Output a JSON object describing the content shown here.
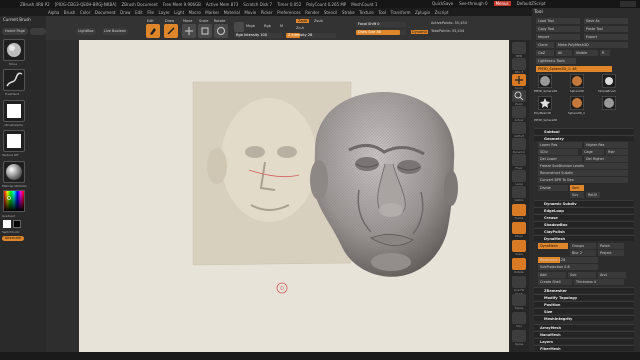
{
  "title": {
    "items": [
      "ZBrush 4R8 P2",
      "[PIOG-CBG3-QE0H-BRGJ-NKBA]",
      "ZBrush Document",
      "Free Mem 9.906GB",
      "Active Mem 873",
      "Scratch Disk 7",
      "Timer 0.052",
      "PolyCount 0.265 MP",
      "MeshCount 1"
    ],
    "quicksave": "QuickSave",
    "seethrough": "See-through  0",
    "menus_label": "Menus",
    "defaultscript": "DefaultZScript"
  },
  "menubar": {
    "items": [
      "Alpha",
      "Brush",
      "Color",
      "Document",
      "Draw",
      "Edit",
      "File",
      "Layer",
      "Light",
      "Macro",
      "Marker",
      "Material",
      "Movie",
      "Picker",
      "Preferences",
      "Render",
      "Stencil",
      "Stroke",
      "Texture",
      "Tool",
      "Transform",
      "Zplugin",
      "Zscript"
    ],
    "hl_index": 19
  },
  "leftbar": {
    "title": "Current Brush",
    "home": "Home Page",
    "lightbox": "LightBox",
    "livebool": "Live Boolean",
    "brush_label": "Move",
    "stroke_label": "FreeHand",
    "alpha_label": "~BrushAlpha",
    "texture_label": "Texture Off",
    "material_label": "MatCap White01",
    "gradient": "Gradient",
    "switchcolor": "SwitchColor",
    "alternate": "Alternate"
  },
  "toolbar": {
    "edit": "Edit",
    "draw": "Draw",
    "move": "Move",
    "scale": "Scale",
    "rotate": "Rotate",
    "mrgb": "Mrgb",
    "rgb": "Rgb",
    "m": "M",
    "zadd": "Zadd",
    "zsub": "Zsub",
    "zcut": "Zcut",
    "rgb_intensity": "Rgb Intensity 100",
    "z_intensity": "Z Intensity 28",
    "focal_shift": "Focal Shift 0",
    "draw_size": "Draw Size 88",
    "dynamic": "Dynamic",
    "active_points": "ActivePoints: 55,434",
    "total_points": "TotalPoints: 55,434",
    "z_intensity_level": 0.28,
    "draw_size_level": 0.88
  },
  "rstrip": [
    "BPR",
    "SPix 3",
    "Scroll",
    "Zoom",
    "Actual",
    "AAHalf",
    "Dynamic Persp",
    "Floor",
    "Local",
    "Gizmo",
    "Frame",
    "Move",
    "Scale",
    "Rotate",
    "Line Fill PolyF",
    "Transp",
    "Solo",
    "Xpose"
  ],
  "toolpanel": {
    "title": "Tool",
    "load": "Load Tool",
    "save": "Save As",
    "copy": "Copy Tool",
    "paste": "Paste Tool",
    "import": "Import",
    "export": "Export",
    "clone": "Clone",
    "make_poly": "Make PolyMesh3D",
    "goz": "GoZ",
    "all": "All",
    "visible": "Visible",
    "r": "R",
    "lightbox_tools": "Lightbox ▸ Tools",
    "current": "PM3D_Sphere3D_1: 48",
    "thumbs": [
      "PM3D_Sphere3D",
      "Sphere3D",
      "SimpleBrush",
      "PolyMesh3D",
      "Sphere3D_1",
      "PM3D_Sphere3D"
    ],
    "subtool": "Subtool",
    "geometry": "Geometry",
    "lower_res": "Lower Res",
    "higher_res": "Higher Res",
    "sdiv": "SDiv",
    "cage": "Cage",
    "rstr": "Rstr",
    "del_lower": "Del Lower",
    "del_higher": "Del Higher",
    "freeze": "Freeze SubDivision Levels",
    "reconstruct": "Reconstruct Subdiv",
    "convert": "Convert BPR To Geo",
    "divide": "Divide",
    "smt": "Smt",
    "suv": "Suv",
    "reuv": "ReUV",
    "dyn_subdiv": "Dynamic Subdiv",
    "edgeloop": "EdgeLoop",
    "crease": "Crease",
    "shadowbox": "ShadowBox",
    "claypolish": "ClayPolish",
    "dynamesh_sec": "DynaMesh",
    "dynamesh": "DynaMesh",
    "groups": "Groups",
    "polish": "Polish",
    "blur": "Blur 2",
    "project": "Project",
    "resolution": "Resolution 128",
    "subproj": "SubProjection 0.6",
    "add": "Add",
    "sub": "Sub",
    "and": "And",
    "create_shell": "Create Shell",
    "thickness": "Thickness 4",
    "zremesher": "ZRemesher",
    "modify_topology": "Modify Topology",
    "position": "Position",
    "size": "Size",
    "meshintegrity": "MeshIntegrity",
    "arraymesh": "ArrayMesh",
    "nanomesh": "NanoMesh",
    "layers": "Layers",
    "fibermesh": "FiberMesh",
    "geometry_hd": "Geometry HD"
  }
}
